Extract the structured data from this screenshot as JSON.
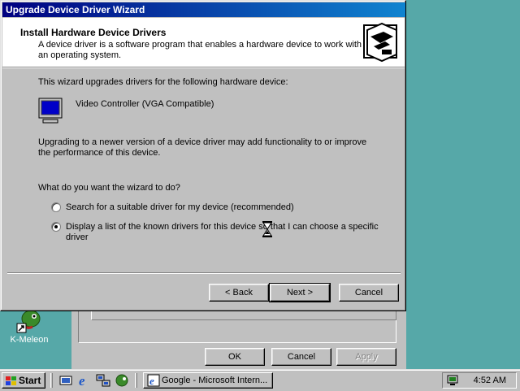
{
  "desktop": {
    "icon_label": "K-Meleon"
  },
  "background_window": {
    "buttons": {
      "ok": "OK",
      "cancel": "Cancel",
      "apply": "Apply"
    }
  },
  "wizard": {
    "title": "Upgrade Device Driver Wizard",
    "header": {
      "title": "Install Hardware Device Drivers",
      "subtitle": "A device driver is a software program that enables a hardware device to work with an operating system."
    },
    "intro": "This wizard upgrades drivers for the following hardware device:",
    "device_name": "Video Controller (VGA Compatible)",
    "upgrade_note": "Upgrading to a newer version of a device driver may add functionality to or improve the performance of this device.",
    "question": "What do you want the wizard to do?",
    "options": [
      {
        "label": "Search for a suitable driver for my device (recommended)",
        "checked": false
      },
      {
        "label": "Display a list of the known drivers for this device so that I can choose a specific driver",
        "checked": true
      }
    ],
    "buttons": {
      "back": "< Back",
      "next": "Next >",
      "cancel": "Cancel"
    }
  },
  "taskbar": {
    "start_label": "Start",
    "task_button": "Google - Microsoft Intern...",
    "clock": "4:52 AM"
  },
  "colors": {
    "desktop": "#56a8a8",
    "titlebar_start": "#000080",
    "titlebar_end": "#1084d0",
    "face": "#c0c0c0"
  }
}
